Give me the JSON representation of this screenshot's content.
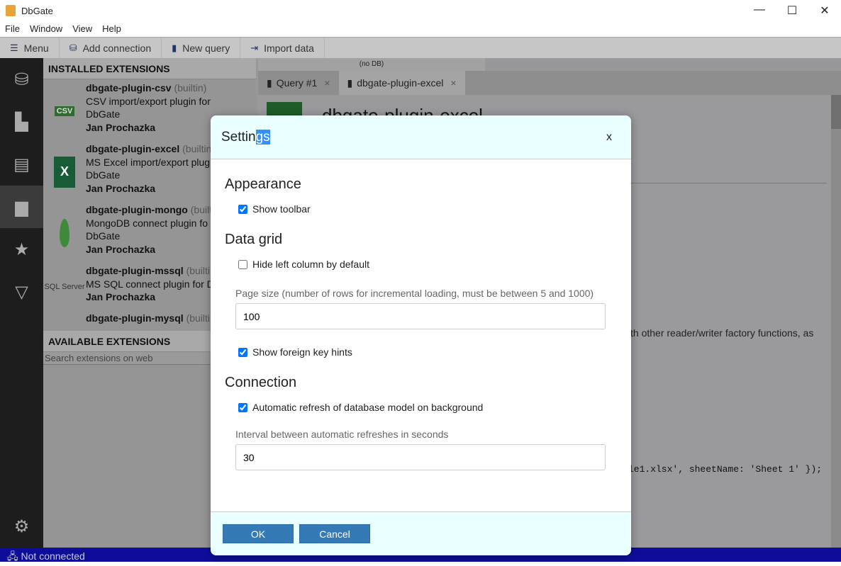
{
  "window": {
    "title": "DbGate",
    "minimize": "—",
    "maximize": "☐",
    "close": "✕"
  },
  "menubar": [
    "File",
    "Window",
    "View",
    "Help"
  ],
  "toolbar": {
    "menu": "Menu",
    "add_connection": "Add connection",
    "new_query": "New query",
    "import_data": "Import data"
  },
  "sidebar": {
    "installed_header": "INSTALLED EXTENSIONS",
    "available_header": "AVAILABLE EXTENSIONS",
    "search_placeholder": "Search extensions on web",
    "extensions": [
      {
        "name": "dbgate-plugin-csv",
        "tag": "(builtin)",
        "desc1": "CSV import/export plugin for",
        "desc2": "DbGate",
        "author": "Jan Prochazka",
        "logo": "CSV"
      },
      {
        "name": "dbgate-plugin-excel",
        "tag": "(builtin)",
        "desc1": "MS Excel import/export plug",
        "desc2": "DbGate",
        "author": "Jan Prochazka",
        "logo": "X"
      },
      {
        "name": "dbgate-plugin-mongo",
        "tag": "(builtin)",
        "desc1": "MongoDB connect plugin fo",
        "desc2": "DbGate",
        "author": "Jan Prochazka",
        "logo": ""
      },
      {
        "name": "dbgate-plugin-mssql",
        "tag": "(builtin)",
        "desc1": "MS SQL connect plugin for D",
        "desc2": "",
        "author": "Jan Prochazka",
        "logo": "SQL Server"
      },
      {
        "name": "dbgate-plugin-mysql",
        "tag": "(builtin)",
        "desc1": "",
        "desc2": "",
        "author": "",
        "logo": ""
      }
    ]
  },
  "tabs": {
    "db_label": "(no DB)",
    "items": [
      {
        "label": "Query #1",
        "close": "×"
      },
      {
        "label": "dbgate-plugin-excel",
        "close": "×"
      }
    ]
  },
  "content": {
    "title": "dbgate-plugin-excel",
    "desc_fragment": "th other reader/writer factory functions, as",
    "code_fragment": "le1.xlsx', sheetName: 'Sheet 1' });"
  },
  "status": {
    "text": "Not connected"
  },
  "settings": {
    "title_a": "Settin",
    "title_sel": "gs",
    "close": "x",
    "appearance": "Appearance",
    "show_toolbar": "Show toolbar",
    "show_toolbar_checked": true,
    "data_grid": "Data grid",
    "hide_left": "Hide left column by default",
    "hide_left_checked": false,
    "page_size_label": "Page size (number of rows for incremental loading, must be between 5 and 1000)",
    "page_size": "100",
    "fk_hints": "Show foreign key hints",
    "fk_hints_checked": true,
    "connection": "Connection",
    "auto_refresh": "Automatic refresh of database model on background",
    "auto_refresh_checked": true,
    "interval_label": "Interval between automatic refreshes in seconds",
    "interval": "30",
    "ok": "OK",
    "cancel": "Cancel"
  }
}
